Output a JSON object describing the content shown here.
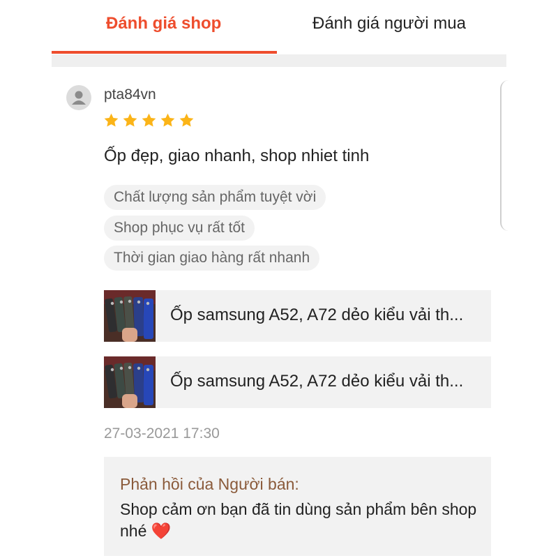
{
  "tabs": [
    {
      "label": "Đánh giá shop",
      "active": true
    },
    {
      "label": "Đánh giá người mua",
      "active": false
    }
  ],
  "accent_color": "#ee4d2d",
  "review": {
    "username": "pta84vn",
    "avatar_icon": "user-icon",
    "rating": 5,
    "rating_max": 5,
    "comment": "Ốp đẹp, giao nhanh, shop nhiet tinh",
    "tags": [
      "Chất lượng sản phẩm tuyệt vời",
      "Shop phục vụ rất tốt",
      "Thời gian giao hàng rất nhanh"
    ],
    "products": [
      {
        "title": "Ốp samsung A52, A72 dẻo kiểu vải th..."
      },
      {
        "title": "Ốp samsung A52, A72 dẻo kiểu vải th..."
      }
    ],
    "timestamp": "27-03-2021 17:30",
    "seller_reply": {
      "label": "Phản hồi của Người bán:",
      "text": "Shop cảm ơn bạn đã tin dùng sản phẩm bên shop nhé",
      "emoji": "❤️"
    }
  }
}
